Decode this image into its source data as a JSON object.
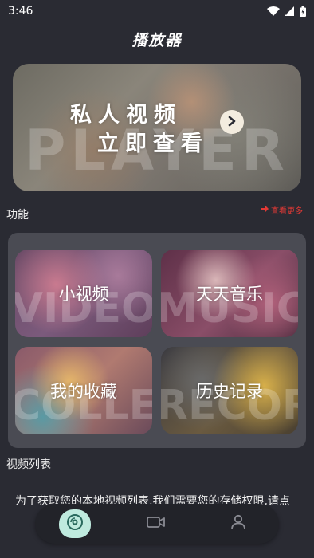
{
  "status_bar": {
    "time": "3:46"
  },
  "app": {
    "title": "播放器"
  },
  "banner": {
    "line1": "私人视频",
    "line2": "立即查看",
    "bg_word": "PLAYER"
  },
  "features": {
    "section_title": "功能",
    "more_label": "查看更多",
    "tiles": [
      {
        "label": "小视频",
        "bg_word": "VIDEO"
      },
      {
        "label": "天天音乐",
        "bg_word": "MUSIC"
      },
      {
        "label": "我的收藏",
        "bg_word": "COLLECT"
      },
      {
        "label": "历史记录",
        "bg_word": "RECORD"
      }
    ]
  },
  "video_list": {
    "section_title": "视频列表",
    "permission_message": "为了获取您的本地视频列表,我们需要您的存储权限,请点"
  },
  "colors": {
    "background": "#2a2b33",
    "panel": "#4a4b53",
    "accent_red": "#e53935",
    "nav_active": "#bfeade",
    "nav_bar": "#222329"
  },
  "icons": {
    "nav": [
      "disc-icon",
      "video-camera-icon",
      "user-icon"
    ],
    "banner_arrow": "chevron-right-icon",
    "more_arrow": "arrow-right-icon"
  }
}
